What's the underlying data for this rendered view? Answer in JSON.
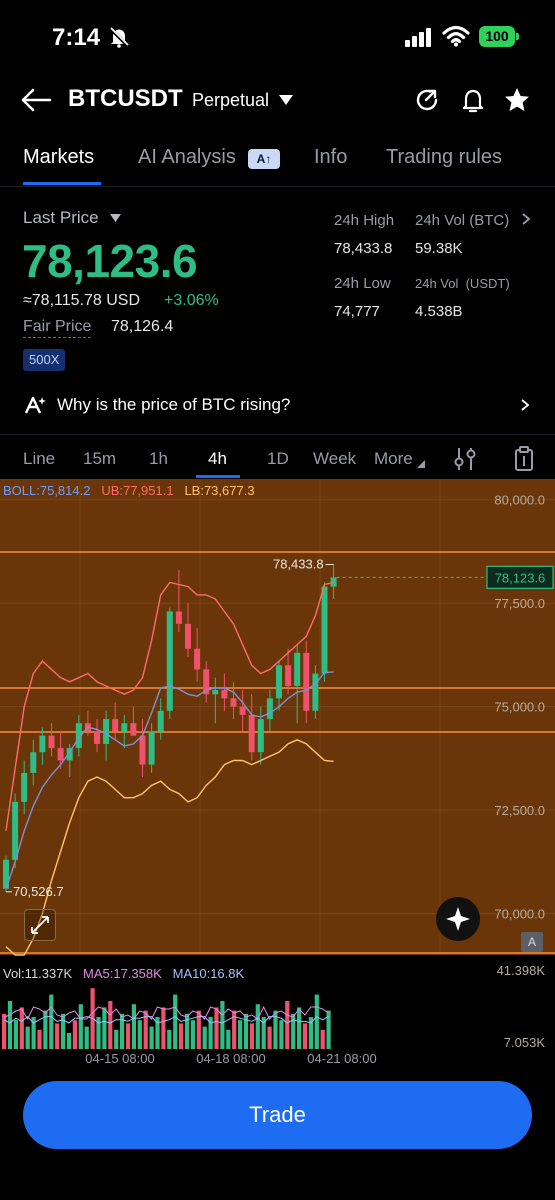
{
  "status": {
    "time": "7:14",
    "battery": "100"
  },
  "header": {
    "symbol": "BTCUSDT",
    "contract_type": "Perpetual"
  },
  "tabs": [
    "Markets",
    "AI Analysis",
    "Info",
    "Trading rules"
  ],
  "ai_badge": "A↑",
  "price": {
    "last_price_label": "Last Price",
    "last_price": "78,123.6",
    "usd_approx": "≈78,115.78 USD",
    "change_pct": "+3.06%",
    "fair_label": "Fair Price",
    "fair_value": "78,126.4",
    "leverage": "500X"
  },
  "stats": {
    "high_label": "24h High",
    "high_value": "78,433.8",
    "vol_btc_label": "24h Vol (BTC)",
    "vol_btc_value": "59.38K",
    "low_label": "24h Low",
    "low_value": "74,777",
    "vol_usdt_label": "24h Vol  (USDT)",
    "vol_usdt_value": "4.538B"
  },
  "ai_question": "Why is the price of BTC rising?",
  "timeframes": [
    "Line",
    "15m",
    "1h",
    "4h",
    "1D",
    "Week",
    "More"
  ],
  "active_timeframe": "4h",
  "colors": {
    "up": "#2ebd85",
    "down": "#f0526e",
    "accent": "#1e6cf2",
    "chart_bg": "#6a3609"
  },
  "chart_data": {
    "type": "candlestick",
    "indicators": {
      "boll": "BOLL:75,814.2",
      "ub": "UB:77,951.1",
      "lb": "LB:73,677.3",
      "vol": "Vol:11.337K",
      "ma5": "MA5:17.358K",
      "ma10": "MA10:16.8K"
    },
    "y_ticks": [
      "80,000.0",
      "77,500.0",
      "75,000.0",
      "72,500.0",
      "70,000.0"
    ],
    "volume_ticks": [
      "41.398K",
      "7.053K"
    ],
    "x_ticks": [
      "04-15 08:00",
      "04-18 08:00",
      "04-21 08:00"
    ],
    "current_price_tag": "78,123.6",
    "high_marker": "78,433.8",
    "low_marker": "70,526.7",
    "ylim": [
      69000,
      80500
    ]
  },
  "a_badge": "A",
  "trade_button": "Trade"
}
